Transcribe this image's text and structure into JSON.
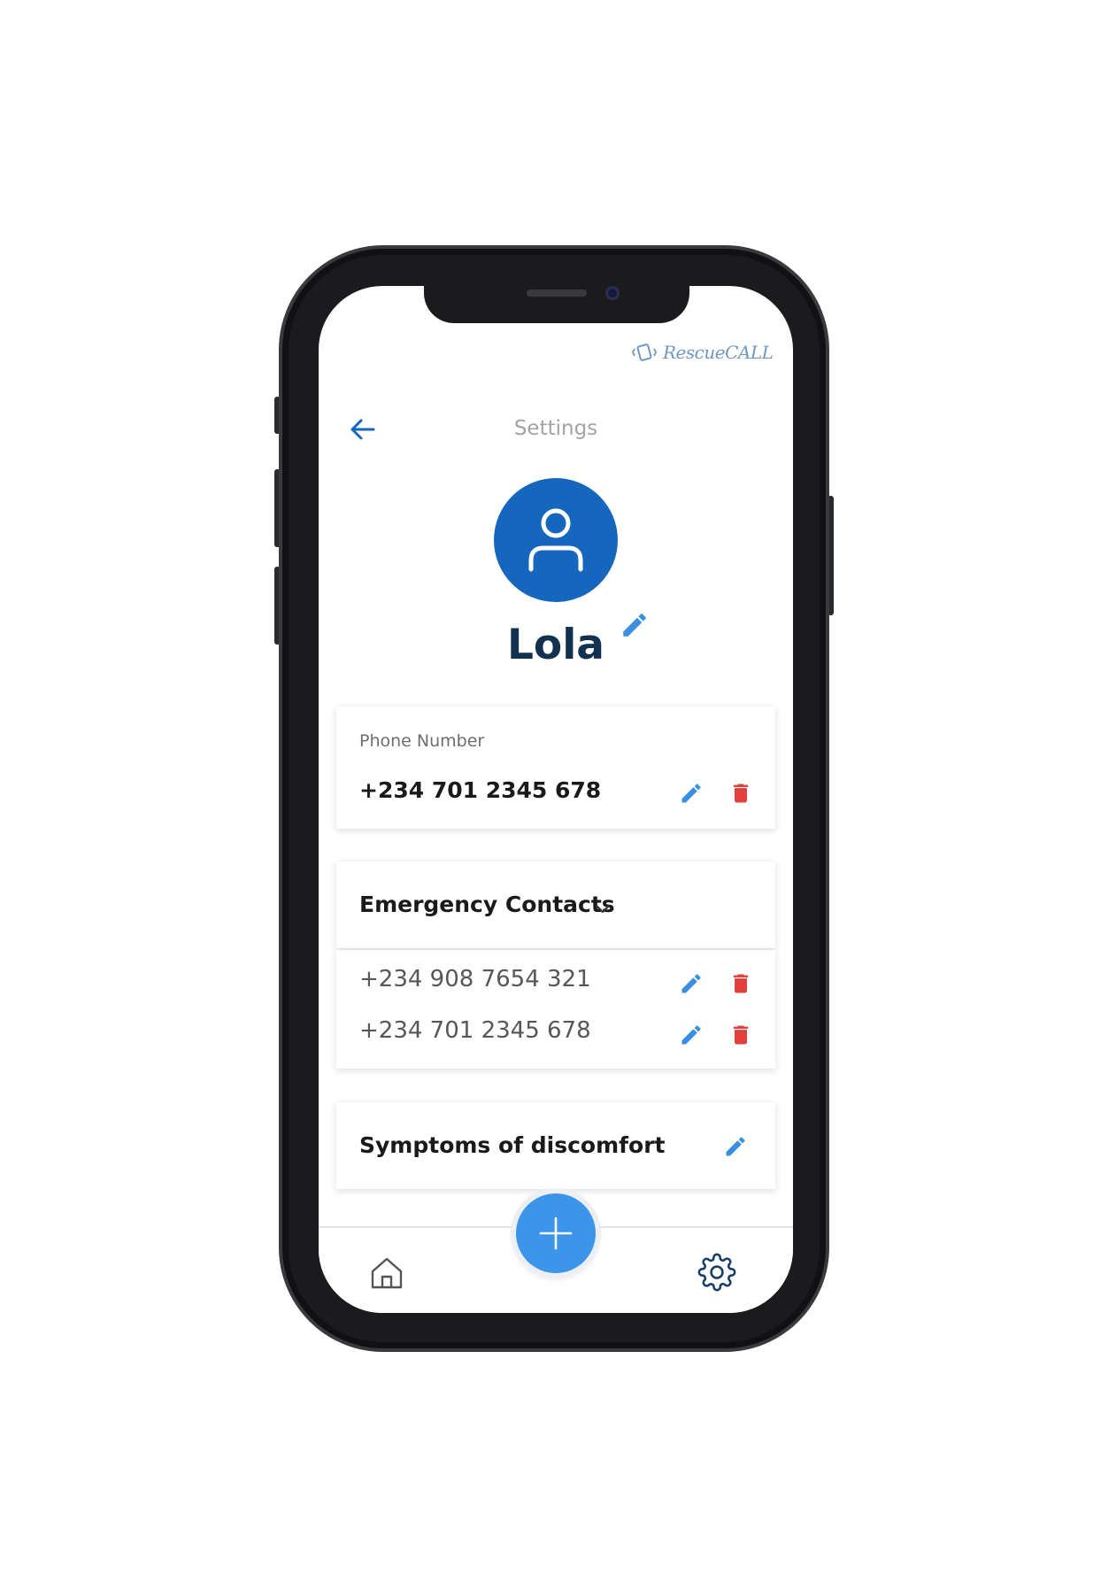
{
  "app": {
    "brand": "RescueCALL",
    "title": "Settings"
  },
  "profile": {
    "name": "Lola"
  },
  "phone_card": {
    "label": "Phone Number",
    "value": "+234 701 2345 678"
  },
  "emergency": {
    "heading": "Emergency Contacts",
    "contacts": [
      {
        "number": "+234 908 7654 321"
      },
      {
        "number": "+234 701 2345 678"
      }
    ]
  },
  "symptoms": {
    "label": "Symptoms of discomfort"
  },
  "icons": {
    "back": "arrow-left-icon",
    "avatar": "user-icon",
    "edit": "pencil-icon",
    "delete": "trash-icon",
    "chevron": "chevron-down-icon",
    "home": "home-icon",
    "settings": "gear-icon",
    "add": "plus-icon"
  },
  "colors": {
    "primary": "#1566bd",
    "accent": "#3d95e9",
    "edit": "#3a8fe0",
    "delete": "#e0413d",
    "name_text": "#12304f",
    "title_text": "#a3a3a3",
    "brand": "#6f98c2"
  }
}
